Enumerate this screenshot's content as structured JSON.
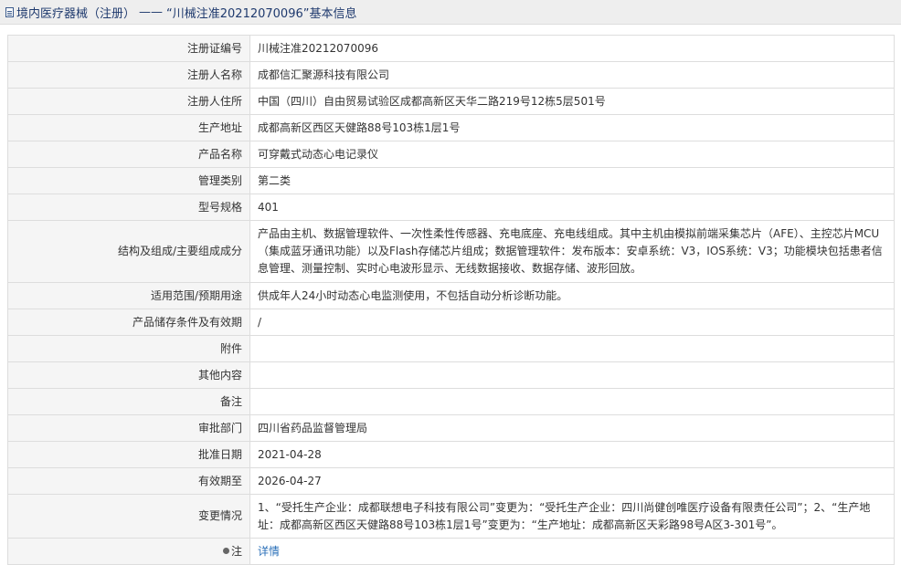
{
  "header": {
    "category": "境内医疗器械（注册）",
    "separator": "——",
    "title": "“川械注准20212070096”基本信息"
  },
  "rows": [
    {
      "label": "注册证编号",
      "value": "川械注准20212070096"
    },
    {
      "label": "注册人名称",
      "value": "成都信汇聚源科技有限公司"
    },
    {
      "label": "注册人住所",
      "value": "中国（四川）自由贸易试验区成都高新区天华二路219号12栋5层501号"
    },
    {
      "label": "生产地址",
      "value": "成都高新区西区天健路88号103栋1层1号"
    },
    {
      "label": "产品名称",
      "value": "可穿戴式动态心电记录仪"
    },
    {
      "label": "管理类别",
      "value": "第二类"
    },
    {
      "label": "型号规格",
      "value": "401"
    },
    {
      "label": "结构及组成/主要组成成分",
      "value": "产品由主机、数据管理软件、一次性柔性传感器、充电底座、充电线组成。其中主机由模拟前端采集芯片（AFE）、主控芯片MCU（集成蓝牙通讯功能）以及Flash存储芯片组成；数据管理软件：发布版本：安卓系统：V3，IOS系统：V3；功能模块包括患者信息管理、测量控制、实时心电波形显示、无线数据接收、数据存储、波形回放。"
    },
    {
      "label": "适用范围/预期用途",
      "value": "供成年人24小时动态心电监测使用，不包括自动分析诊断功能。"
    },
    {
      "label": "产品储存条件及有效期",
      "value": "/"
    },
    {
      "label": "附件",
      "value": ""
    },
    {
      "label": "其他内容",
      "value": ""
    },
    {
      "label": "备注",
      "value": ""
    },
    {
      "label": "审批部门",
      "value": "四川省药品监督管理局"
    },
    {
      "label": "批准日期",
      "value": "2021-04-28"
    },
    {
      "label": "有效期至",
      "value": "2026-04-27"
    },
    {
      "label": "变更情况",
      "value": "1、“受托生产企业：成都联想电子科技有限公司”变更为：“受托生产企业：四川尚健创唯医疗设备有限责任公司”；2、“生产地址：成都高新区西区天健路88号103栋1层1号”变更为：“生产地址：成都高新区天彩路98号A区3-301号”。"
    },
    {
      "label": "注",
      "value": "详情"
    }
  ],
  "colors": {
    "label_bg": "#f5f5f5",
    "border": "#dddddd",
    "link": "#2a6fb8",
    "header_bg": "#eeeeee"
  },
  "icons": {
    "header_icon": "document-icon",
    "note_icon": "bulb-icon"
  }
}
